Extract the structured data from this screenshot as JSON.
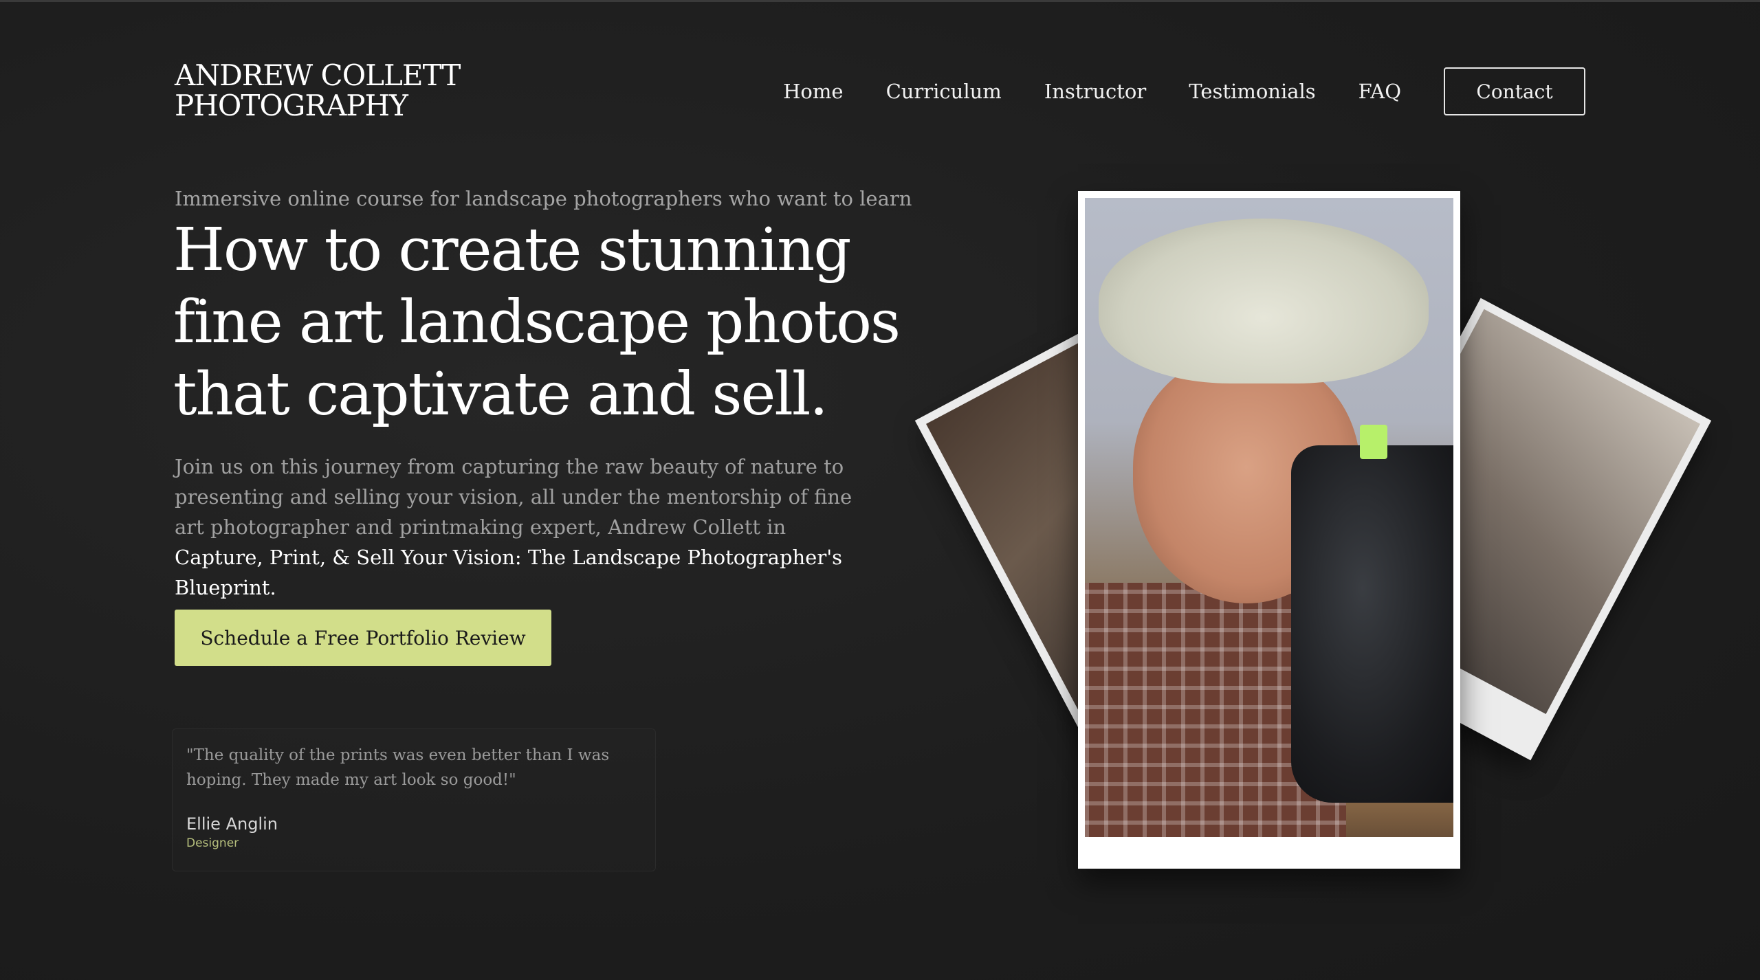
{
  "brand": {
    "line1": "ANDREW COLLETT",
    "line2": "PHOTOGRAPHY"
  },
  "nav": {
    "items": [
      {
        "label": "Home"
      },
      {
        "label": "Curriculum"
      },
      {
        "label": "Instructor"
      },
      {
        "label": "Testimonials"
      },
      {
        "label": "FAQ"
      }
    ],
    "contact_label": "Contact"
  },
  "hero": {
    "kicker": "Immersive online course for landscape photographers who want to learn",
    "headline": "How to create stunning fine art landscape photos that captivate and sell.",
    "intro_plain": "Join us on this journey from capturing the raw beauty of nature to presenting and selling your vision, all under the mentorship of fine art photographer and printmaking expert, Andrew Collett in ",
    "intro_highlight": "Capture, Print, & Sell Your Vision: The Landscape Photographer's Blueprint.",
    "cta_label": "Schedule a Free Portfolio Review"
  },
  "testimonial": {
    "quote": "\"The quality of the prints was even better than I was hoping. They made my art look so good!\"",
    "author": "Ellie Anglin",
    "role": "Designer"
  },
  "colors": {
    "background": "#1f1f1f",
    "cta_bg": "#d2de8a",
    "role_accent": "#b6bf7d"
  }
}
